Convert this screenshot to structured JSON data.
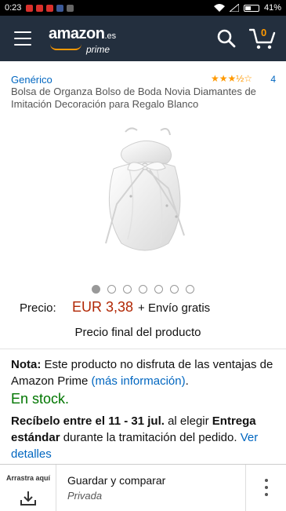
{
  "status": {
    "time": "0:23",
    "battery": "41%",
    "notification_colors": [
      "#d9302c",
      "#d9302c",
      "#d9302c",
      "#3b5998",
      "#666666"
    ]
  },
  "appbar": {
    "logo_main": "amazon",
    "logo_tld": ".es",
    "logo_prime": "prime",
    "cart_count": "0",
    "colors": {
      "bar": "#232f3e",
      "accent": "#ff9900"
    }
  },
  "product": {
    "brand": "Genérico",
    "rating_stars": "★★★½☆",
    "rating_count": "4",
    "title": "Bolsa de Organza Bolso de Boda Novia Diamantes de Imitación Decoración para Regalo Blanco",
    "image_count": 7,
    "active_image": 0
  },
  "price": {
    "label": "Precio:",
    "value": "EUR 3,38",
    "shipping": "+ Envío gratis",
    "final": "Precio final del producto"
  },
  "note": {
    "label": "Nota:",
    "text": " Este producto no disfruta de las ventajas de Amazon Prime ",
    "link": "(más información)",
    "end": "."
  },
  "stock": "En stock.",
  "delivery": {
    "bold1": "Recíbelo entre el 11 - 31 jul.",
    "text1": " al elegir ",
    "bold2": "Entrega estándar",
    "text2": " durante la tramitación del pedido. ",
    "link": "Ver detalles"
  },
  "bottom": {
    "drag_label": "Arrastra aquí",
    "compare_title": "Guardar y comparar",
    "compare_sub": "Privada"
  }
}
